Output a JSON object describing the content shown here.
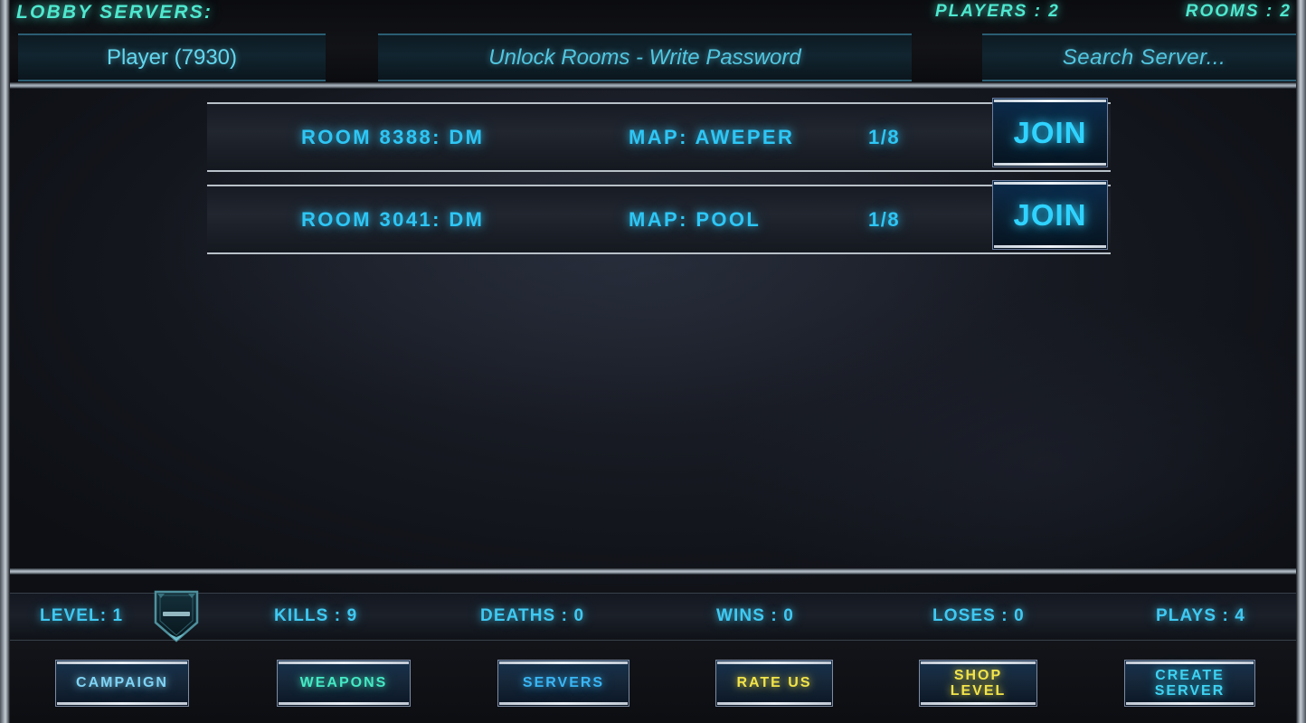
{
  "header": {
    "title": "LOBBY SERVERS:",
    "players_label": "PLAYERS : 2",
    "rooms_label": "ROOMS : 2",
    "player_field": {
      "name": "player-name-input",
      "value": "Player (7930)",
      "placeholder": "Player (7930)"
    },
    "password_field": {
      "name": "unlock-rooms-password-input",
      "value": "",
      "placeholder": "Unlock Rooms - Write Password"
    },
    "search_field": {
      "name": "search-server-input",
      "value": "",
      "placeholder": "Search  Server..."
    }
  },
  "rooms": [
    {
      "name": "ROOM 8388: DM",
      "map": "MAP: AWEPER",
      "slots": "1/8",
      "join_label": "JOIN"
    },
    {
      "name": "ROOM 3041: DM",
      "map": "MAP: POOL",
      "slots": "1/8",
      "join_label": "JOIN"
    }
  ],
  "stats": [
    {
      "key": "level",
      "label": "LEVEL: 1"
    },
    {
      "key": "kills",
      "label": "KILLS : 9"
    },
    {
      "key": "deaths",
      "label": "DEATHS : 0"
    },
    {
      "key": "wins",
      "label": "WINS : 0"
    },
    {
      "key": "loses",
      "label": "LOSES : 0"
    },
    {
      "key": "plays",
      "label": "PLAYS : 4"
    }
  ],
  "level_badge": {
    "icon": "shield-rank-badge-icon"
  },
  "nav": [
    {
      "key": "campaign",
      "label": "CAMPAIGN",
      "color": "#7fd4f5"
    },
    {
      "key": "weapons",
      "label": "WEAPONS",
      "color": "#45e9c4"
    },
    {
      "key": "servers",
      "label": "SERVERS",
      "color": "#3ab6f5"
    },
    {
      "key": "rate-us",
      "label": "RATE US",
      "color": "#f2e44a"
    },
    {
      "key": "shop-level",
      "label": "SHOP\nLEVEL",
      "color": "#f2e44a"
    },
    {
      "key": "create-server",
      "label": "CREATE\nSERVER",
      "color": "#3fd2f2"
    }
  ],
  "colors": {
    "accent_cyan": "#2ec6f5",
    "accent_teal": "#4fe8cf",
    "accent_yellow": "#f2e44a",
    "frame_gray": "#b9c1c8",
    "background": "#171a22"
  }
}
